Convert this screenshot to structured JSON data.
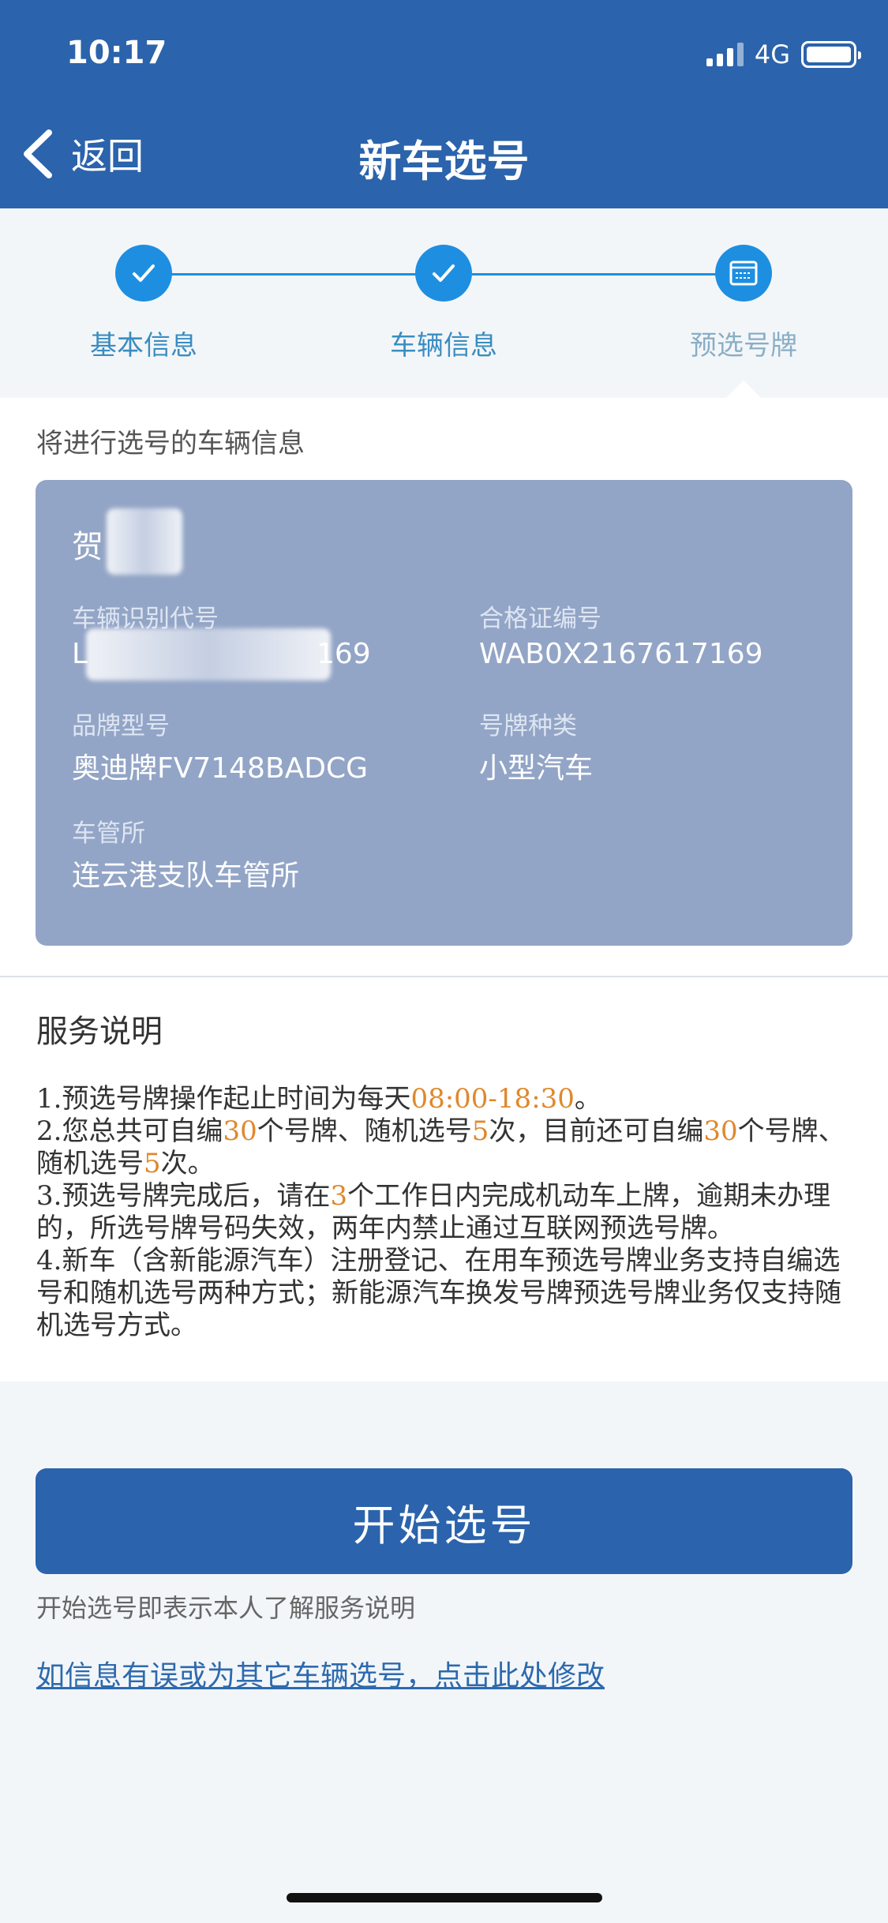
{
  "status_bar": {
    "time": "10:17",
    "network": "4G"
  },
  "nav": {
    "back_label": "返回",
    "title": "新车选号"
  },
  "steps": [
    {
      "label": "基本信息",
      "state": "done"
    },
    {
      "label": "车辆信息",
      "state": "done"
    },
    {
      "label": "预选号牌",
      "state": "current"
    }
  ],
  "vehicle": {
    "caption": "将进行选号的车辆信息",
    "owner_visible": "贺",
    "vin_label": "车辆识别代号",
    "vin_visible_start": "L",
    "vin_visible_end": "169",
    "certificate_label": "合格证编号",
    "certificate_value": "WAB0X2167617169",
    "brand_label": "品牌型号",
    "brand_value": "奥迪牌FV7148BADCG",
    "plate_type_label": "号牌种类",
    "plate_type_value": "小型汽车",
    "office_label": "车管所",
    "office_value": "连云港支队车管所"
  },
  "service": {
    "title": "服务说明",
    "note1": {
      "a": "1.预选号牌操作起止时间为每天",
      "time": "08:00-18:30",
      "b": "。"
    },
    "note2": {
      "a": "2.您总共可自编",
      "n1": "30",
      "b": "个号牌、随机选号",
      "n2": "5",
      "c": "次，目前还可自编",
      "n3": "30",
      "d": "个号牌、随机选号",
      "n4": "5",
      "e": "次。"
    },
    "note3": {
      "a": "3.预选号牌完成后，请在",
      "n": "3",
      "b": "个工作日内完成机动车上牌，逾期未办理的，所选号牌号码失效，两年内禁止通过互联网预选号牌。"
    },
    "note4": "4.新车（含新能源汽车）注册登记、在用车预选号牌业务支持自编选号和随机选号两种方式；新能源汽车换发号牌预选号牌业务仅支持随机选号方式。"
  },
  "actions": {
    "start_label": "开始选号",
    "hint": "开始选号即表示本人了解服务说明",
    "modify_link": "如信息有误或为其它车辆选号，点击此处修改"
  },
  "colors": {
    "primary": "#2b63ac",
    "step_blue": "#1e8fe0",
    "card": "#93a5c6",
    "highlight": "#e0882c"
  },
  "icons": [
    "back-chevron-icon",
    "signal-icon",
    "battery-icon",
    "check-icon",
    "plate-form-icon"
  ]
}
